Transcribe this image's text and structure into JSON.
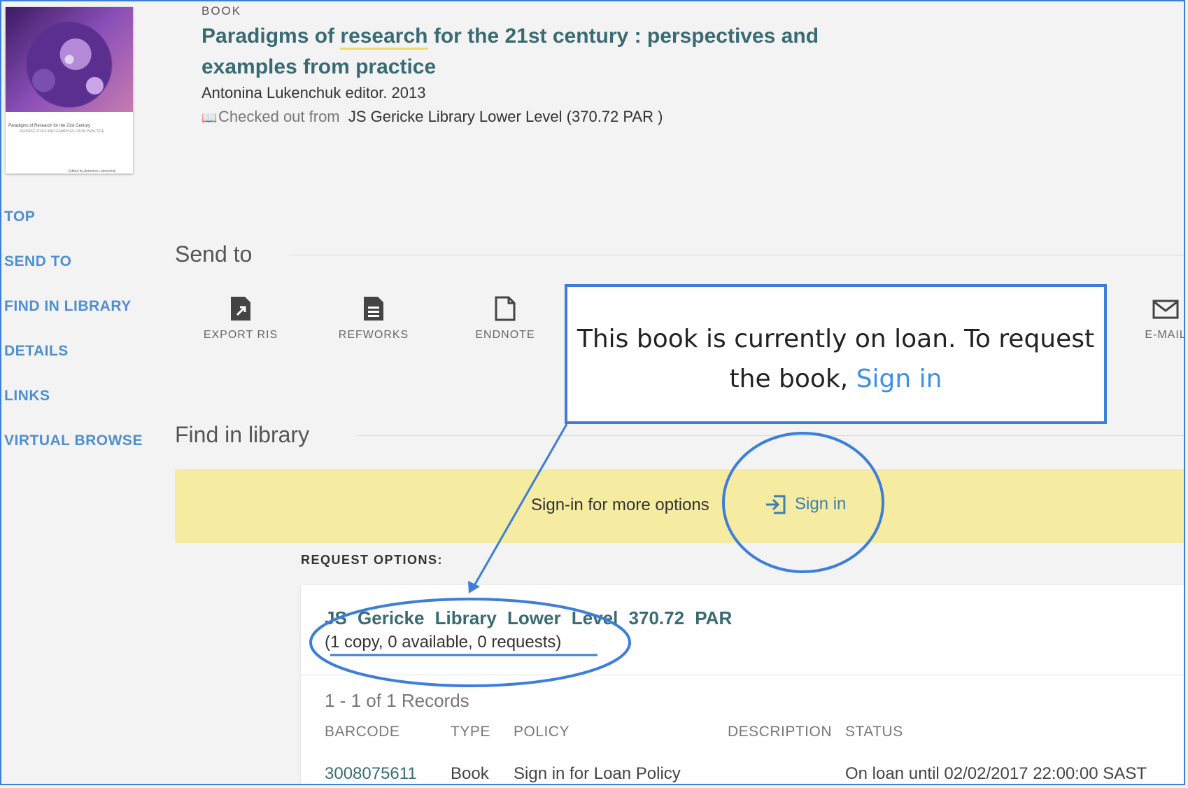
{
  "record": {
    "type_label": "BOOK",
    "title_before": "Paradigms of ",
    "title_highlight": "research",
    "title_after": " for the 21st century : perspectives and examples from practice",
    "author_line": "Antonina Lukenchuk editor. 2013",
    "availability_prefix": "Checked out from",
    "availability_location": "JS Gericke Library Lower Level (370.72 PAR )",
    "cover": {
      "title": "Paradigms of Research for the 21st Century",
      "subtitle": "PERSPECTIVES AND EXAMPLES FROM PRACTICE",
      "editor": "Edited by Antonina Lukenchuk"
    }
  },
  "nav": {
    "items": [
      "TOP",
      "SEND TO",
      "FIND IN LIBRARY",
      "DETAILS",
      "LINKS",
      "VIRTUAL BROWSE"
    ]
  },
  "send_to": {
    "title": "Send to",
    "items": [
      {
        "label": "EXPORT RIS",
        "icon": "export-ris-icon"
      },
      {
        "label": "REFWORKS",
        "icon": "refworks-icon"
      },
      {
        "label": "ENDNOTE",
        "icon": "endnote-icon"
      },
      {
        "label": "E-MAIL",
        "icon": "email-icon"
      }
    ]
  },
  "callout": {
    "text": "This book is currently on loan. To request the book,",
    "link": "Sign in"
  },
  "find_in_library": {
    "title": "Find in library",
    "signin_text": "Sign-in for more options",
    "signin_link": "Sign in",
    "request_options_label": "REQUEST OPTIONS:",
    "holding": {
      "location": "JS Gericke Library  Lower Level  370.72 PAR",
      "counts": "(1 copy, 0 available, 0 requests)"
    },
    "records_label": "1 - 1 of 1 Records",
    "columns": [
      "BARCODE",
      "TYPE",
      "POLICY",
      "DESCRIPTION",
      "STATUS"
    ],
    "rows": [
      {
        "barcode": "3008075611",
        "type": "Book",
        "policy": "Sign in for Loan Policy",
        "description": "",
        "status": "On loan until 02/02/2017 22:00:00 SAST"
      }
    ]
  },
  "colors": {
    "accent_blue": "#3d7fd8",
    "nav_blue": "#4f8fd1",
    "title_teal": "#3a6b73",
    "signin_bar_yellow": "#f5eca1",
    "highlight_yellow": "#f0dc6e"
  }
}
